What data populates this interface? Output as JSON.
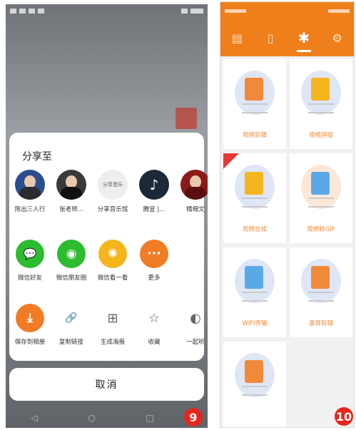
{
  "left_screen": {
    "share_title": "分享至",
    "contacts": [
      {
        "label": "陈出三人行",
        "avatar_color": "#2a4d8f"
      },
      {
        "label": "张老师...",
        "avatar_color": "#3a3a3a"
      },
      {
        "label": "分享音乐馆",
        "avatar_color": "#e9e9e9",
        "avatar_text": "分享音乐"
      },
      {
        "label": "腾宣 |...",
        "avatar_color": "#1b2838",
        "avatar_text": "♪"
      },
      {
        "label": "精细文",
        "avatar_color": "#8b1a1a"
      }
    ],
    "apps": [
      {
        "label": "微信好友",
        "color": "#2dbb2f",
        "icon": "wechat-icon",
        "glyph": "💬"
      },
      {
        "label": "微信朋友圈",
        "color": "#2dbb2f",
        "icon": "moments-icon",
        "glyph": "◉"
      },
      {
        "label": "微信看一看",
        "color": "#f5b51d",
        "icon": "look-icon",
        "glyph": "✺"
      },
      {
        "label": "更多",
        "color": "#f07d26",
        "icon": "more-icon",
        "glyph": "···"
      }
    ],
    "actions": [
      {
        "label": "保存到相册",
        "icon": "download-icon",
        "glyph": "⤓",
        "color": "#f07d26"
      },
      {
        "label": "复制链接",
        "icon": "link-icon",
        "glyph": "🔗"
      },
      {
        "label": "生成海报",
        "icon": "grid-icon",
        "glyph": "⊞"
      },
      {
        "label": "收藏",
        "icon": "star-icon",
        "glyph": "☆"
      },
      {
        "label": "一起听",
        "icon": "listen-icon",
        "glyph": "◐"
      }
    ],
    "cancel_label": "取消",
    "badge": "9"
  },
  "right_screen": {
    "tabs": [
      {
        "icon": "file-icon",
        "glyph": "▤"
      },
      {
        "icon": "phone-icon",
        "glyph": "▯"
      },
      {
        "icon": "tools-icon",
        "glyph": "✱",
        "active": true
      },
      {
        "icon": "settings-icon",
        "glyph": "⚙"
      }
    ],
    "cards": [
      {
        "label": "视频剪辑",
        "device_color": "#f08a3a"
      },
      {
        "label": "视频拼接",
        "device_color": "#f5b51d"
      },
      {
        "label": "视频合成",
        "device_color": "#f5b51d",
        "ribbon": true
      },
      {
        "label": "视频转GIF",
        "device_color": "#5aa9e6"
      },
      {
        "label": "WIFI传输",
        "device_color": "#5aa9e6"
      },
      {
        "label": "录屏剪辑",
        "device_color": "#f08a3a"
      },
      {
        "label": "",
        "device_color": "#f08a3a"
      }
    ],
    "badge": "10"
  }
}
